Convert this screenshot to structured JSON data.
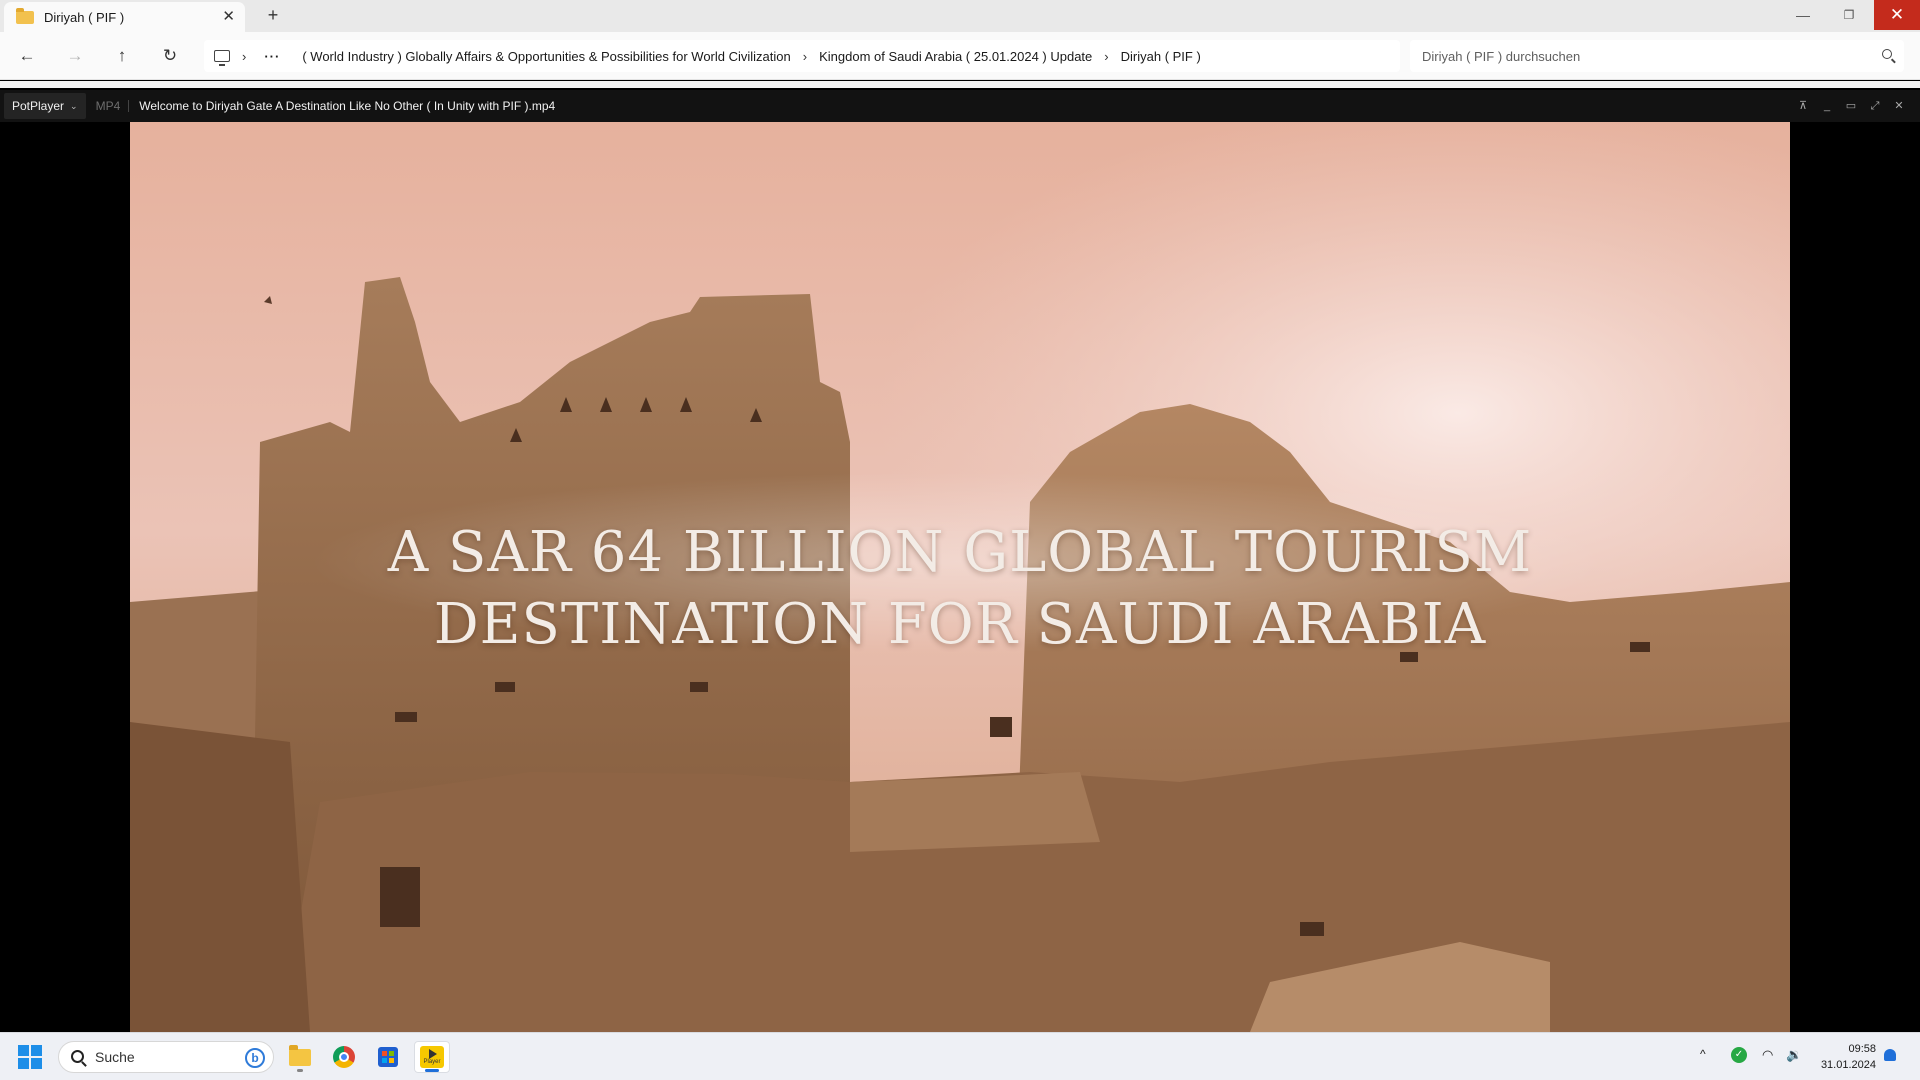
{
  "explorer": {
    "tab_title": "Diriyah ( PIF )",
    "tab_close": "✕",
    "new_tab": "+",
    "window_controls": {
      "minimize": "—",
      "maximize": "❐",
      "close": "✕"
    },
    "nav": {
      "back": "←",
      "forward": "→",
      "up": "↑",
      "refresh": "↻"
    },
    "breadcrumb": {
      "more": "···",
      "separator": "›",
      "items": [
        "( World Industry ) Globally Affairs & Opportunities & Possibilities for World Civilization",
        "Kingdom of Saudi Arabia ( 25.01.2024 ) Update",
        "Diriyah ( PIF )"
      ]
    },
    "search_placeholder": "Diriyah ( PIF ) durchsuchen"
  },
  "player": {
    "menu_label": "PotPlayer",
    "menu_caret": "⌄",
    "format": "MP4",
    "file_name": "Welcome to Diriyah Gate  A Destination Like No Other ( In Unity with PIF ).mp4",
    "controls": {
      "pin": "⊼",
      "minimize": "_",
      "maximize": "▭",
      "fullscreen": "⤢",
      "close": "✕"
    },
    "subtitle_lines": [
      "A SAR 64 BILLION GLOBAL TOURISM",
      "DESTINATION FOR SAUDI ARABIA"
    ]
  },
  "taskbar": {
    "search_label": "Suche",
    "bing_label": "b",
    "pinned_apps": [
      "file-explorer",
      "chrome",
      "microsoft-store",
      "potplayer"
    ],
    "potplayer_icon_text": "Player",
    "tray": {
      "chevron": "^",
      "shield": "✓",
      "wifi": "◠",
      "volume": "🔉"
    },
    "time": "09:58",
    "date": "31.01.2024"
  }
}
